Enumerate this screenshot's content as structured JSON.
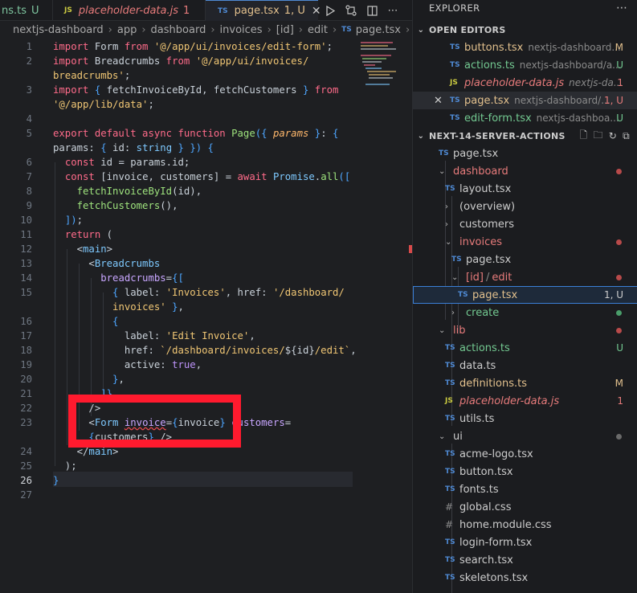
{
  "tabs": [
    {
      "file": "ns.ts",
      "status": "U"
    },
    {
      "file": "placeholder-data.js",
      "status": "1",
      "type": "JS"
    },
    {
      "file": "page.tsx",
      "status": "1, U",
      "type": "TS"
    }
  ],
  "breadcrumb": [
    "nextjs-dashboard",
    "app",
    "dashboard",
    "invoices",
    "[id]",
    "edit",
    "page.tsx",
    "P"
  ],
  "code_lines": [
    {
      "n": "1"
    },
    {
      "n": "2"
    },
    {
      "n": ""
    },
    {
      "n": "3"
    },
    {
      "n": ""
    },
    {
      "n": "4"
    },
    {
      "n": "5"
    },
    {
      "n": ""
    },
    {
      "n": "6"
    },
    {
      "n": "7"
    },
    {
      "n": "8"
    },
    {
      "n": "9"
    },
    {
      "n": "10"
    },
    {
      "n": "11"
    },
    {
      "n": "12"
    },
    {
      "n": "13"
    },
    {
      "n": "14"
    },
    {
      "n": "15"
    },
    {
      "n": ""
    },
    {
      "n": "16"
    },
    {
      "n": "17"
    },
    {
      "n": "18"
    },
    {
      "n": "19"
    },
    {
      "n": "20"
    },
    {
      "n": "21"
    },
    {
      "n": "22"
    },
    {
      "n": "23"
    },
    {
      "n": ""
    },
    {
      "n": "24"
    },
    {
      "n": "25"
    },
    {
      "n": "26"
    },
    {
      "n": "27"
    }
  ],
  "explorer": {
    "title": "EXPLORER",
    "open_editors_label": "OPEN EDITORS",
    "open_editors": [
      {
        "type": "TS",
        "name": "buttons.tsx",
        "path": "nextjs-dashboard...",
        "badge": "M"
      },
      {
        "type": "TS",
        "name": "actions.ts",
        "path": "nextjs-dashboard/a...",
        "badge": "U"
      },
      {
        "type": "JS",
        "name": "placeholder-data.js",
        "path": "nextjs-da...",
        "badge": "1"
      },
      {
        "type": "TS",
        "name": "page.tsx",
        "path": "nextjs-dashboard/...",
        "badge": "1, U"
      },
      {
        "type": "TS",
        "name": "edit-form.tsx",
        "path": "nextjs-dashboa...",
        "badge": "U"
      }
    ],
    "project_label": "NEXT-14-SERVER-ACTIONS",
    "tree": [
      {
        "type": "TS",
        "name": "page.tsx",
        "badge": ""
      },
      {
        "type": "folder",
        "name": "dashboard",
        "badge": "dot"
      },
      {
        "type": "TS",
        "name": "layout.tsx",
        "badge": ""
      },
      {
        "type": "folder-closed",
        "name": "(overview)",
        "badge": ""
      },
      {
        "type": "folder-closed",
        "name": "customers",
        "badge": ""
      },
      {
        "type": "folder",
        "name": "invoices",
        "badge": "dot"
      },
      {
        "type": "TS",
        "name": "page.tsx",
        "badge": ""
      },
      {
        "type": "folder",
        "name": "[id]",
        "name2": "edit",
        "badge": "dot"
      },
      {
        "type": "TS",
        "name": "page.tsx",
        "badge": "1, U"
      },
      {
        "type": "folder-closed",
        "name": "create",
        "badge": "dot-green"
      },
      {
        "type": "folder",
        "name": "lib",
        "badge": "dot"
      },
      {
        "type": "TS",
        "name": "actions.ts",
        "badge": "U"
      },
      {
        "type": "TS",
        "name": "data.ts",
        "badge": ""
      },
      {
        "type": "TS",
        "name": "definitions.ts",
        "badge": "M"
      },
      {
        "type": "JS",
        "name": "placeholder-data.js",
        "badge": "1"
      },
      {
        "type": "TS",
        "name": "utils.ts",
        "badge": ""
      },
      {
        "type": "folder",
        "name": "ui",
        "badge": "dot-grey"
      },
      {
        "type": "TS",
        "name": "acme-logo.tsx",
        "badge": ""
      },
      {
        "type": "TS",
        "name": "button.tsx",
        "badge": ""
      },
      {
        "type": "TS",
        "name": "fonts.ts",
        "badge": ""
      },
      {
        "type": "#",
        "name": "global.css",
        "badge": ""
      },
      {
        "type": "#",
        "name": "home.module.css",
        "badge": ""
      },
      {
        "type": "TS",
        "name": "login-form.tsx",
        "badge": ""
      },
      {
        "type": "TS",
        "name": "search.tsx",
        "badge": ""
      },
      {
        "type": "TS",
        "name": "skeletons.tsx",
        "badge": ""
      }
    ]
  },
  "colors": {
    "highlight_box": "#ff1a2e",
    "modified": "#e2c08d",
    "untracked": "#73c991",
    "error": "#e77b7b"
  }
}
